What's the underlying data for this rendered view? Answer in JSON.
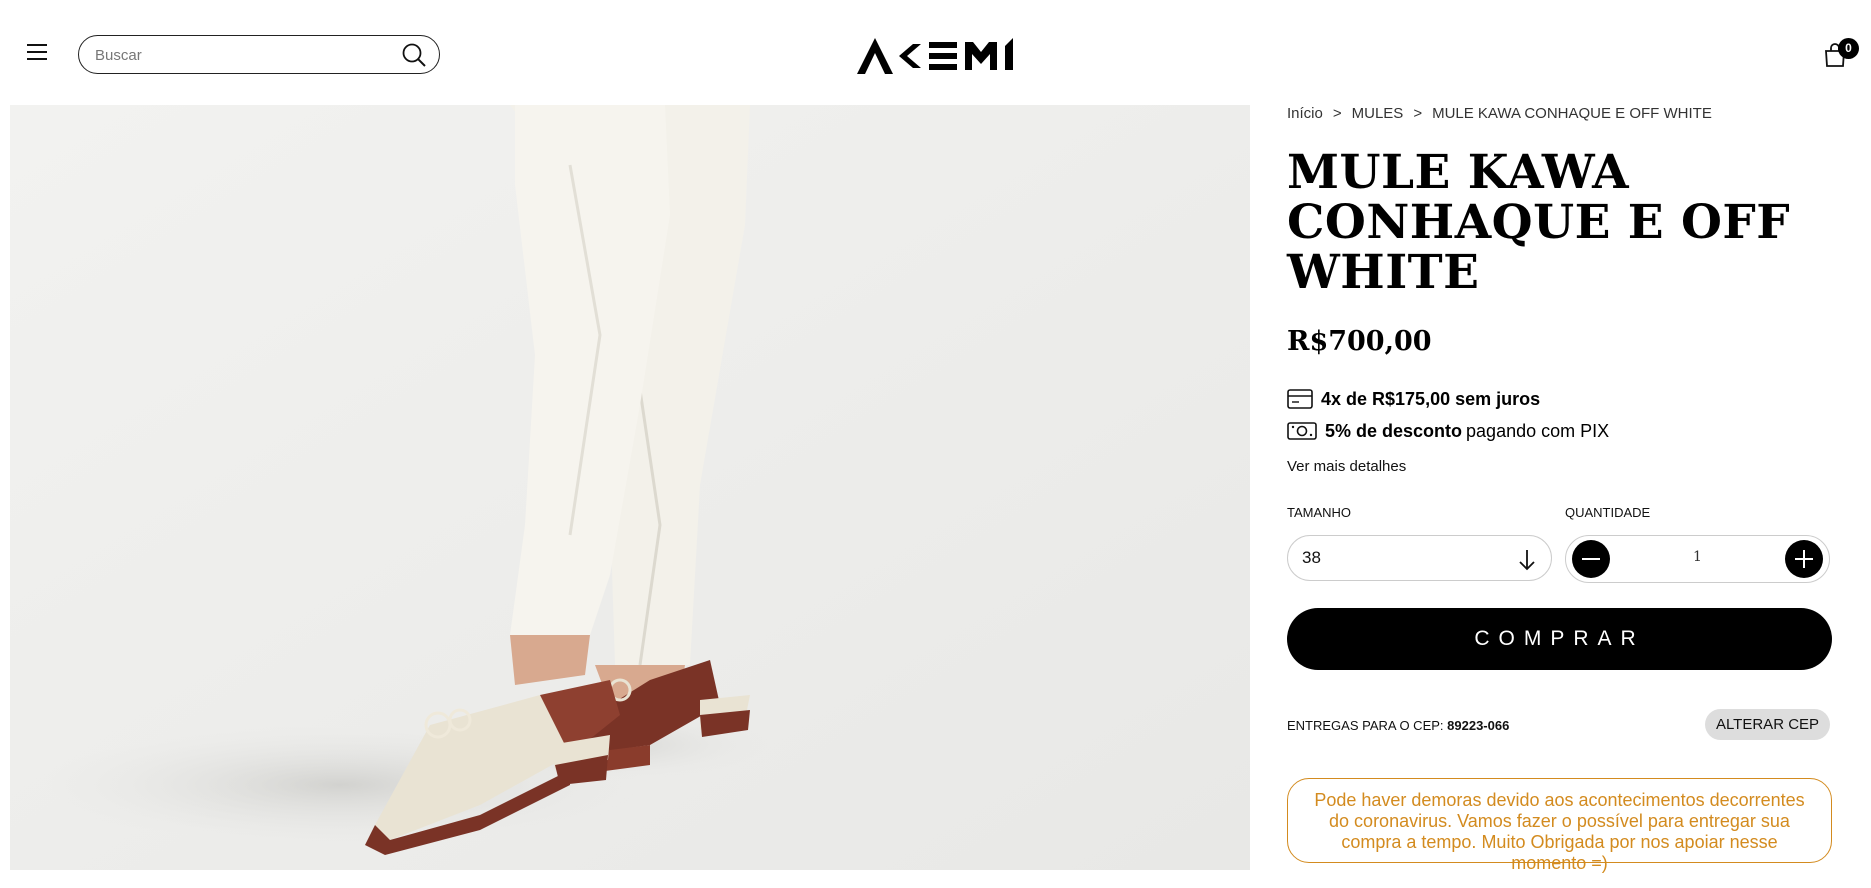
{
  "header": {
    "search_placeholder": "Buscar",
    "logo_alt": "AKEMI",
    "cart_count": "0"
  },
  "breadcrumb": {
    "items": [
      "Início",
      "MULES",
      "MULE KAWA CONHAQUE E OFF WHITE"
    ],
    "separator": ">"
  },
  "product": {
    "title": "MULE KAWA CONHAQUE E OFF WHITE",
    "price": "R$700,00",
    "installments": "4x de R$175,00 sem juros",
    "pix_discount_bold": "5% de desconto",
    "pix_discount_rest": "pagando com PIX",
    "more_details": "Ver mais detalhes",
    "image_colors": {
      "background": "#eeeeec",
      "pants": "#f4f2ea",
      "shoe_cream": "#e9e3d3",
      "shoe_brown": "#7a3326"
    }
  },
  "options": {
    "size_label": "TAMANHO",
    "size_value": "38",
    "quantity_label": "QUANTIDADE",
    "quantity_value": "1"
  },
  "buy_button": "COMPRAR",
  "shipping": {
    "label": "ENTREGAS PARA O CEP:",
    "cep": "89223-066",
    "change_button": "ALTERAR CEP"
  },
  "notice": {
    "text": "Pode haver demoras devido aos acontecimentos decorrentes do coronavirus. Vamos fazer o possível para entregar sua compra a tempo. Muito Obrigada por nos apoiar nesse momento =)",
    "color": "#d38b1f"
  },
  "icons": {
    "menu": "hamburger-icon",
    "search": "magnifier-icon",
    "cart": "shopping-bag-icon",
    "card": "credit-card-icon",
    "money": "cash-icon",
    "select_arrow": "arrow-down-icon",
    "minus": "minus-icon",
    "plus": "plus-icon"
  }
}
